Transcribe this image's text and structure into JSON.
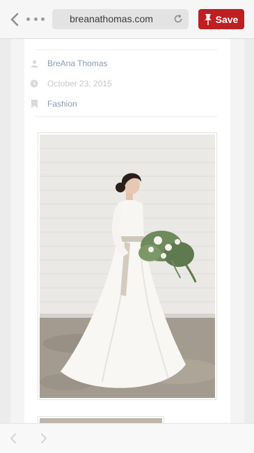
{
  "browser": {
    "url": "breanathomas.com",
    "save_label": "Save",
    "icons": {
      "back": "chevron-left-icon",
      "more": "more-dots-icon",
      "reload": "reload-icon",
      "pin": "pin-icon"
    },
    "colors": {
      "save_button": "#bd1f22",
      "url_bar": "#e3e3e3"
    }
  },
  "post_meta": {
    "author": "BreAna Thomas",
    "date": "October 23, 2015",
    "category": "Fashion",
    "colors": {
      "author": "#8a9ab0",
      "date": "#c6c6c6",
      "category": "#8a9ab0"
    }
  },
  "bottom_toolbar": {
    "back_enabled": false,
    "forward_enabled": false
  }
}
